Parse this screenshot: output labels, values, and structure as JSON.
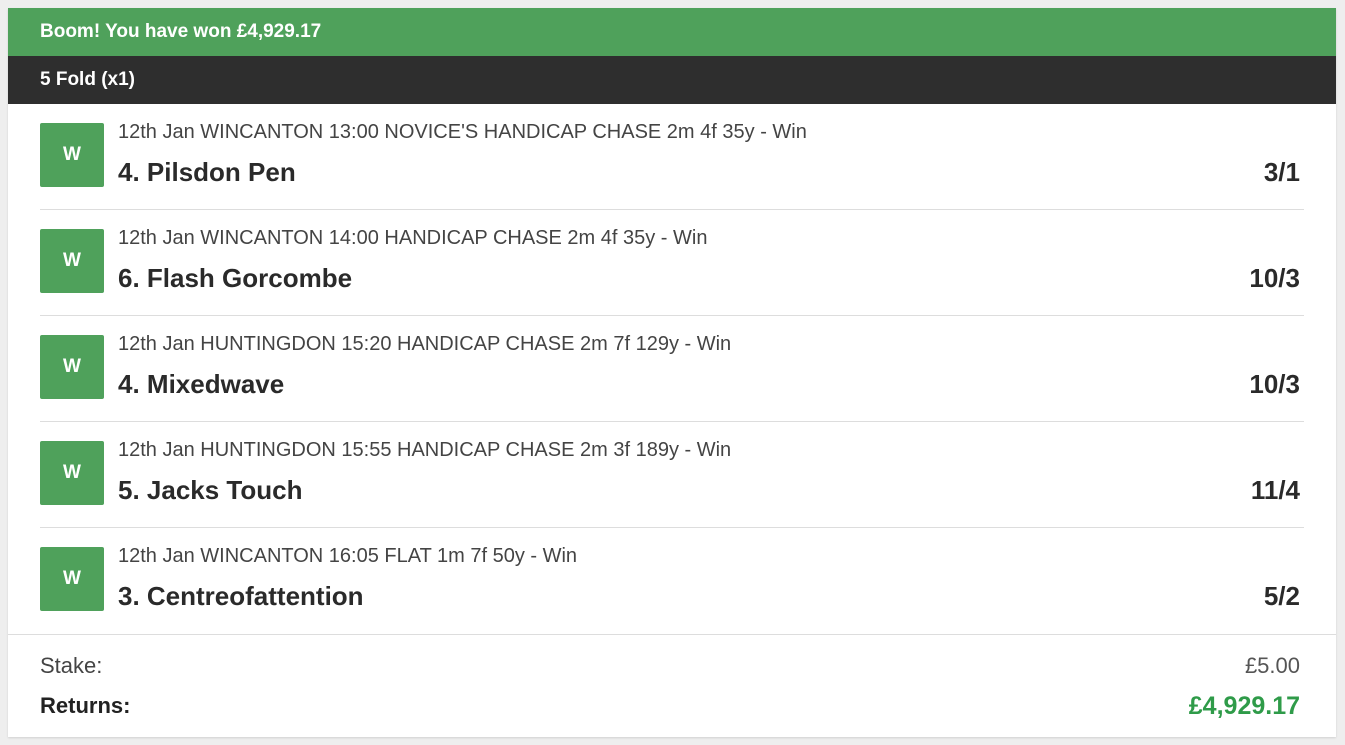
{
  "banner": {
    "text": "Boom! You have won £4,929.17"
  },
  "bet": {
    "title": "5 Fold (x1)"
  },
  "legs": [
    {
      "badge": "W",
      "description": "12th Jan WINCANTON 13:00 NOVICE'S HANDICAP CHASE 2m 4f 35y - Win",
      "runner": "4. Pilsdon Pen",
      "odds": "3/1"
    },
    {
      "badge": "W",
      "description": "12th Jan WINCANTON 14:00 HANDICAP CHASE 2m 4f 35y - Win",
      "runner": "6. Flash Gorcombe",
      "odds": "10/3"
    },
    {
      "badge": "W",
      "description": "12th Jan HUNTINGDON 15:20 HANDICAP CHASE 2m 7f 129y - Win",
      "runner": "4. Mixedwave",
      "odds": "10/3"
    },
    {
      "badge": "W",
      "description": "12th Jan HUNTINGDON 15:55 HANDICAP CHASE 2m 3f 189y - Win",
      "runner": "5. Jacks Touch",
      "odds": "11/4"
    },
    {
      "badge": "W",
      "description": "12th Jan WINCANTON 16:05 FLAT 1m 7f 50y - Win",
      "runner": "3. Centreofattention",
      "odds": "5/2"
    }
  ],
  "summary": {
    "stake_label": "Stake:",
    "stake_value": "£5.00",
    "returns_label": "Returns:",
    "returns_value": "£4,929.17"
  },
  "colors": {
    "win_green": "#4fa15b",
    "header_dark": "#2e2e2e",
    "returns_green": "#2f9b49"
  }
}
